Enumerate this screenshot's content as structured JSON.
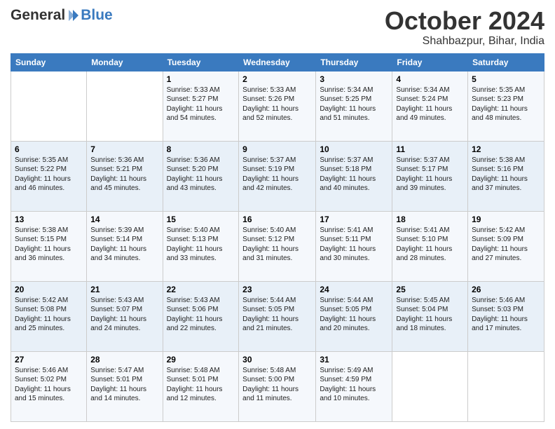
{
  "header": {
    "logo": {
      "general": "General",
      "blue": "Blue",
      "icon": "▶"
    },
    "title": "October 2024",
    "location": "Shahbazpur, Bihar, India"
  },
  "days_of_week": [
    "Sunday",
    "Monday",
    "Tuesday",
    "Wednesday",
    "Thursday",
    "Friday",
    "Saturday"
  ],
  "weeks": [
    [
      null,
      null,
      {
        "day": 1,
        "sunrise": "Sunrise: 5:33 AM",
        "sunset": "Sunset: 5:27 PM",
        "daylight": "Daylight: 11 hours and 54 minutes."
      },
      {
        "day": 2,
        "sunrise": "Sunrise: 5:33 AM",
        "sunset": "Sunset: 5:26 PM",
        "daylight": "Daylight: 11 hours and 52 minutes."
      },
      {
        "day": 3,
        "sunrise": "Sunrise: 5:34 AM",
        "sunset": "Sunset: 5:25 PM",
        "daylight": "Daylight: 11 hours and 51 minutes."
      },
      {
        "day": 4,
        "sunrise": "Sunrise: 5:34 AM",
        "sunset": "Sunset: 5:24 PM",
        "daylight": "Daylight: 11 hours and 49 minutes."
      },
      {
        "day": 5,
        "sunrise": "Sunrise: 5:35 AM",
        "sunset": "Sunset: 5:23 PM",
        "daylight": "Daylight: 11 hours and 48 minutes."
      }
    ],
    [
      {
        "day": 6,
        "sunrise": "Sunrise: 5:35 AM",
        "sunset": "Sunset: 5:22 PM",
        "daylight": "Daylight: 11 hours and 46 minutes."
      },
      {
        "day": 7,
        "sunrise": "Sunrise: 5:36 AM",
        "sunset": "Sunset: 5:21 PM",
        "daylight": "Daylight: 11 hours and 45 minutes."
      },
      {
        "day": 8,
        "sunrise": "Sunrise: 5:36 AM",
        "sunset": "Sunset: 5:20 PM",
        "daylight": "Daylight: 11 hours and 43 minutes."
      },
      {
        "day": 9,
        "sunrise": "Sunrise: 5:37 AM",
        "sunset": "Sunset: 5:19 PM",
        "daylight": "Daylight: 11 hours and 42 minutes."
      },
      {
        "day": 10,
        "sunrise": "Sunrise: 5:37 AM",
        "sunset": "Sunset: 5:18 PM",
        "daylight": "Daylight: 11 hours and 40 minutes."
      },
      {
        "day": 11,
        "sunrise": "Sunrise: 5:37 AM",
        "sunset": "Sunset: 5:17 PM",
        "daylight": "Daylight: 11 hours and 39 minutes."
      },
      {
        "day": 12,
        "sunrise": "Sunrise: 5:38 AM",
        "sunset": "Sunset: 5:16 PM",
        "daylight": "Daylight: 11 hours and 37 minutes."
      }
    ],
    [
      {
        "day": 13,
        "sunrise": "Sunrise: 5:38 AM",
        "sunset": "Sunset: 5:15 PM",
        "daylight": "Daylight: 11 hours and 36 minutes."
      },
      {
        "day": 14,
        "sunrise": "Sunrise: 5:39 AM",
        "sunset": "Sunset: 5:14 PM",
        "daylight": "Daylight: 11 hours and 34 minutes."
      },
      {
        "day": 15,
        "sunrise": "Sunrise: 5:40 AM",
        "sunset": "Sunset: 5:13 PM",
        "daylight": "Daylight: 11 hours and 33 minutes."
      },
      {
        "day": 16,
        "sunrise": "Sunrise: 5:40 AM",
        "sunset": "Sunset: 5:12 PM",
        "daylight": "Daylight: 11 hours and 31 minutes."
      },
      {
        "day": 17,
        "sunrise": "Sunrise: 5:41 AM",
        "sunset": "Sunset: 5:11 PM",
        "daylight": "Daylight: 11 hours and 30 minutes."
      },
      {
        "day": 18,
        "sunrise": "Sunrise: 5:41 AM",
        "sunset": "Sunset: 5:10 PM",
        "daylight": "Daylight: 11 hours and 28 minutes."
      },
      {
        "day": 19,
        "sunrise": "Sunrise: 5:42 AM",
        "sunset": "Sunset: 5:09 PM",
        "daylight": "Daylight: 11 hours and 27 minutes."
      }
    ],
    [
      {
        "day": 20,
        "sunrise": "Sunrise: 5:42 AM",
        "sunset": "Sunset: 5:08 PM",
        "daylight": "Daylight: 11 hours and 25 minutes."
      },
      {
        "day": 21,
        "sunrise": "Sunrise: 5:43 AM",
        "sunset": "Sunset: 5:07 PM",
        "daylight": "Daylight: 11 hours and 24 minutes."
      },
      {
        "day": 22,
        "sunrise": "Sunrise: 5:43 AM",
        "sunset": "Sunset: 5:06 PM",
        "daylight": "Daylight: 11 hours and 22 minutes."
      },
      {
        "day": 23,
        "sunrise": "Sunrise: 5:44 AM",
        "sunset": "Sunset: 5:05 PM",
        "daylight": "Daylight: 11 hours and 21 minutes."
      },
      {
        "day": 24,
        "sunrise": "Sunrise: 5:44 AM",
        "sunset": "Sunset: 5:05 PM",
        "daylight": "Daylight: 11 hours and 20 minutes."
      },
      {
        "day": 25,
        "sunrise": "Sunrise: 5:45 AM",
        "sunset": "Sunset: 5:04 PM",
        "daylight": "Daylight: 11 hours and 18 minutes."
      },
      {
        "day": 26,
        "sunrise": "Sunrise: 5:46 AM",
        "sunset": "Sunset: 5:03 PM",
        "daylight": "Daylight: 11 hours and 17 minutes."
      }
    ],
    [
      {
        "day": 27,
        "sunrise": "Sunrise: 5:46 AM",
        "sunset": "Sunset: 5:02 PM",
        "daylight": "Daylight: 11 hours and 15 minutes."
      },
      {
        "day": 28,
        "sunrise": "Sunrise: 5:47 AM",
        "sunset": "Sunset: 5:01 PM",
        "daylight": "Daylight: 11 hours and 14 minutes."
      },
      {
        "day": 29,
        "sunrise": "Sunrise: 5:48 AM",
        "sunset": "Sunset: 5:01 PM",
        "daylight": "Daylight: 11 hours and 12 minutes."
      },
      {
        "day": 30,
        "sunrise": "Sunrise: 5:48 AM",
        "sunset": "Sunset: 5:00 PM",
        "daylight": "Daylight: 11 hours and 11 minutes."
      },
      {
        "day": 31,
        "sunrise": "Sunrise: 5:49 AM",
        "sunset": "Sunset: 4:59 PM",
        "daylight": "Daylight: 11 hours and 10 minutes."
      },
      null,
      null
    ]
  ]
}
